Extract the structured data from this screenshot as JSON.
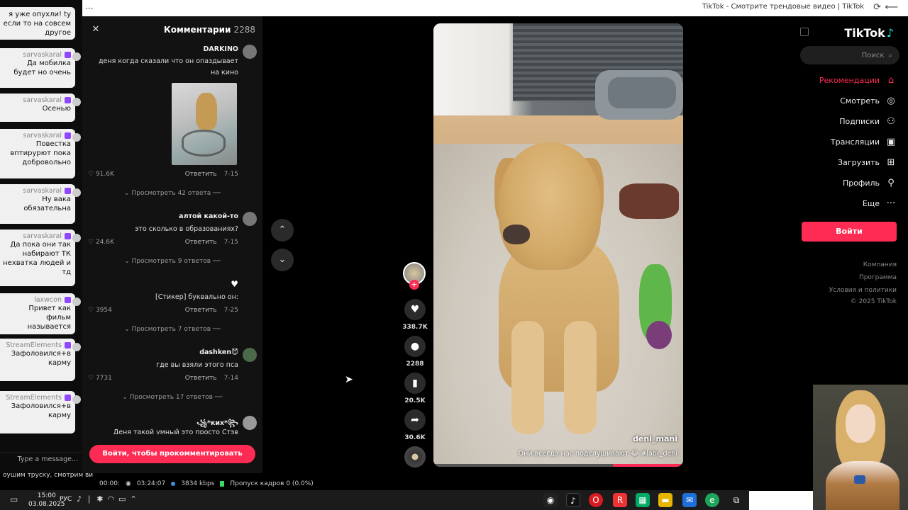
{
  "browser": {
    "title": "TikTok - Смотрите трендовые видео | TikTok",
    "a11y": "Aあ",
    "close": "✕",
    "maximize": "☐",
    "minimize": "—",
    "more": "···"
  },
  "chat": {
    "top_fragment_1": "я уже опухли! ty",
    "top_fragment_2": "если то на совсем",
    "top_fragment_3": "другое",
    "messages": [
      {
        "user": "sarvaskaral",
        "text": "Да мобилка будет но очень"
      },
      {
        "user": "sarvaskaral",
        "text": "Осенью"
      },
      {
        "user": "sarvaskaral",
        "text": "Повестка вптирурют пока добровольно"
      },
      {
        "user": "sarvaskaral",
        "text": "Ну вака обязательна"
      },
      {
        "user": "sarvaskaral",
        "text": "Да пока они так набирают ТК нехватка людей и тд"
      },
      {
        "user": "laxwcon",
        "text": "Привет как фильм называется"
      },
      {
        "user": "StreamElements",
        "text": "Зафоловился+в карму"
      },
      {
        "user": "StreamElements",
        "text": "Зафоловился+в карму"
      }
    ],
    "type_placeholder": "Type a message...",
    "footer": "оушим труску, смотрим ви"
  },
  "comments": {
    "title": "Комментарии",
    "count": "2288",
    "items": [
      {
        "author": "DARKINO",
        "text": "деня когда сказали что он опаздывает на кино",
        "time": "7-15",
        "reply": "Ответить",
        "likes": "91.6K",
        "more": "Просмотреть 42 ответа"
      },
      {
        "author": "алтой какой-то",
        "text": "это сколько в образованиях?",
        "time": "7-15",
        "reply": "Ответить",
        "likes": "24.6K",
        "more": "Просмотреть 9 ответов"
      },
      {
        "author": "♥",
        "text": "[Стикер] буквально он:",
        "time": "7-25",
        "reply": "Ответить",
        "likes": "3954",
        "more": "Просмотреть 7 ответов"
      },
      {
        "author": "dashken😈",
        "text": "где вы взяли этого пса",
        "time": "7-14",
        "reply": "Ответить",
        "likes": "7731",
        "more": "Просмотреть 17 ответов"
      },
      {
        "author": "꧁*ких*꧂",
        "text": "Деня такой умный это просто Стэв дейк",
        "time": "",
        "reply": "",
        "likes": "",
        "more": ""
      }
    ],
    "login_cta": "Войти, чтобы прокомментировать",
    "close": "✕"
  },
  "video": {
    "username": "deni_mani",
    "caption": "Они всегда нас подслушивают 😂 #labr_deni",
    "progress": 0.28
  },
  "actions": {
    "likes": "338.7K",
    "comments": "2288",
    "saves": "20.5K",
    "shares": "30.6K"
  },
  "tiktok": {
    "logo": "TikTok",
    "search_placeholder": "Поиск",
    "nav": [
      {
        "label": "Рекомендации",
        "icon": "⌂",
        "active": true
      },
      {
        "label": "Смотреть",
        "icon": "◎",
        "active": false
      },
      {
        "label": "Подписки",
        "icon": "⚇",
        "active": false
      },
      {
        "label": "Трансляции",
        "icon": "▣",
        "active": false
      },
      {
        "label": "Загрузить",
        "icon": "⊞",
        "active": false
      },
      {
        "label": "Профиль",
        "icon": "⚲",
        "active": false
      },
      {
        "label": "Еще",
        "icon": "···",
        "active": false
      }
    ],
    "login": "Войти",
    "footer": [
      "Компания",
      "Программа",
      "Условия и политики",
      "© 2025 TikTok"
    ]
  },
  "stream_stats": {
    "dropped": "Пропуск кадров 0 (0.0%)",
    "bitrate": "3834 kbps",
    "duration": "03:24:07",
    "extra": "00:00:"
  },
  "taskbar": {
    "time": "15:00",
    "date": "03.08.2025",
    "lang": "РУС"
  }
}
